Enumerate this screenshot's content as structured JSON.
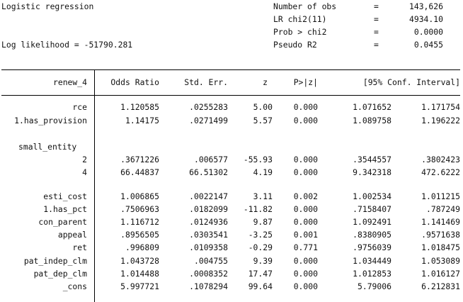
{
  "header": {
    "title": "Logistic regression",
    "log_likelihood": "Log likelihood = -51790.281",
    "stats": [
      {
        "label": "Number of obs",
        "eq": "=",
        "value": "143,626"
      },
      {
        "label": "LR chi2(11)",
        "eq": "=",
        "value": "4934.10"
      },
      {
        "label": "Prob > chi2",
        "eq": "=",
        "value": "0.0000"
      },
      {
        "label": "Pseudo R2",
        "eq": "=",
        "value": "0.0455"
      }
    ]
  },
  "table": {
    "columns": [
      "renew_4",
      "Odds Ratio",
      "Std. Err.",
      "z",
      "P>|z|",
      "[95% Conf. Interval]"
    ],
    "rows": [
      {
        "var": "rce",
        "or": "1.120585",
        "se": ".0255283",
        "z": "5.00",
        "p": "0.000",
        "lo": "1.071652",
        "hi": "1.171754"
      },
      {
        "var": "1.has_provision",
        "or": "1.14175",
        "se": ".0271499",
        "z": "5.57",
        "p": "0.000",
        "lo": "1.089758",
        "hi": "1.196222"
      },
      {
        "var": "",
        "or": "",
        "se": "",
        "z": "",
        "p": "",
        "lo": "",
        "hi": ""
      },
      {
        "var": "small_entity",
        "or": "",
        "se": "",
        "z": "",
        "p": "",
        "lo": "",
        "hi": "",
        "heading": true
      },
      {
        "var": "2",
        "or": ".3671226",
        "se": ".006577",
        "z": "-55.93",
        "p": "0.000",
        "lo": ".3544557",
        "hi": ".3802423"
      },
      {
        "var": "4",
        "or": "66.44837",
        "se": "66.51302",
        "z": "4.19",
        "p": "0.000",
        "lo": "9.342318",
        "hi": "472.6222"
      },
      {
        "var": "",
        "or": "",
        "se": "",
        "z": "",
        "p": "",
        "lo": "",
        "hi": ""
      },
      {
        "var": "esti_cost",
        "or": "1.006865",
        "se": ".0022147",
        "z": "3.11",
        "p": "0.002",
        "lo": "1.002534",
        "hi": "1.011215"
      },
      {
        "var": "1.has_pct",
        "or": ".7506963",
        "se": ".0182099",
        "z": "-11.82",
        "p": "0.000",
        "lo": ".7158407",
        "hi": ".787249"
      },
      {
        "var": "con_parent",
        "or": "1.116712",
        "se": ".0124936",
        "z": "9.87",
        "p": "0.000",
        "lo": "1.092491",
        "hi": "1.141469"
      },
      {
        "var": "appeal",
        "or": ".8956505",
        "se": ".0303541",
        "z": "-3.25",
        "p": "0.001",
        "lo": ".8380905",
        "hi": ".9571638"
      },
      {
        "var": "ret",
        "or": ".996809",
        "se": ".0109358",
        "z": "-0.29",
        "p": "0.771",
        "lo": ".9756039",
        "hi": "1.018475"
      },
      {
        "var": "pat_indep_clm",
        "or": "1.043728",
        "se": ".004755",
        "z": "9.39",
        "p": "0.000",
        "lo": "1.034449",
        "hi": "1.053089"
      },
      {
        "var": "pat_dep_clm",
        "or": "1.014488",
        "se": ".0008352",
        "z": "17.47",
        "p": "0.000",
        "lo": "1.012853",
        "hi": "1.016127"
      },
      {
        "var": "_cons",
        "or": "5.997721",
        "se": ".1078294",
        "z": "99.64",
        "p": "0.000",
        "lo": "5.79006",
        "hi": "6.212831"
      }
    ]
  }
}
